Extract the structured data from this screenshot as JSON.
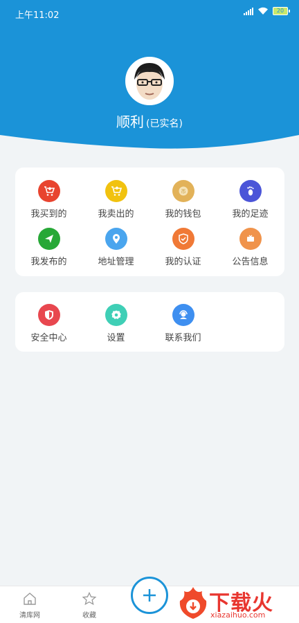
{
  "status": {
    "time": "上午11:02",
    "battery": "20"
  },
  "profile": {
    "name": "顺利",
    "verified_tag": "(已实名)"
  },
  "grid1": [
    {
      "label": "我买到的",
      "icon": "cart-download-icon",
      "color": "#e8442f"
    },
    {
      "label": "我卖出的",
      "icon": "cart-upload-icon",
      "color": "#f1c20f"
    },
    {
      "label": "我的钱包",
      "icon": "wallet-coin-icon",
      "color": "#e2b259"
    },
    {
      "label": "我的足迹",
      "icon": "footprint-icon",
      "color": "#4b55d8"
    },
    {
      "label": "我发布的",
      "icon": "paper-plane-icon",
      "color": "#27a837"
    },
    {
      "label": "地址管理",
      "icon": "location-pin-icon",
      "color": "#4aa5ee"
    },
    {
      "label": "我的认证",
      "icon": "shield-check-icon",
      "color": "#f07936"
    },
    {
      "label": "公告信息",
      "icon": "announcement-icon",
      "color": "#f0934b"
    }
  ],
  "grid2": [
    {
      "label": "安全中心",
      "icon": "security-shield-icon",
      "color": "#e8474f"
    },
    {
      "label": "设置",
      "icon": "gear-icon",
      "color": "#3fcfb6"
    },
    {
      "label": "联系我们",
      "icon": "customer-service-icon",
      "color": "#3e8ff0"
    }
  ],
  "nav": {
    "home": "清库网",
    "favorites": "收藏"
  },
  "watermark": {
    "title": "下载火",
    "subtitle": "xiazaihuo.com"
  },
  "colors": {
    "primary": "#1b93d8",
    "background": "#f1f4f6"
  }
}
